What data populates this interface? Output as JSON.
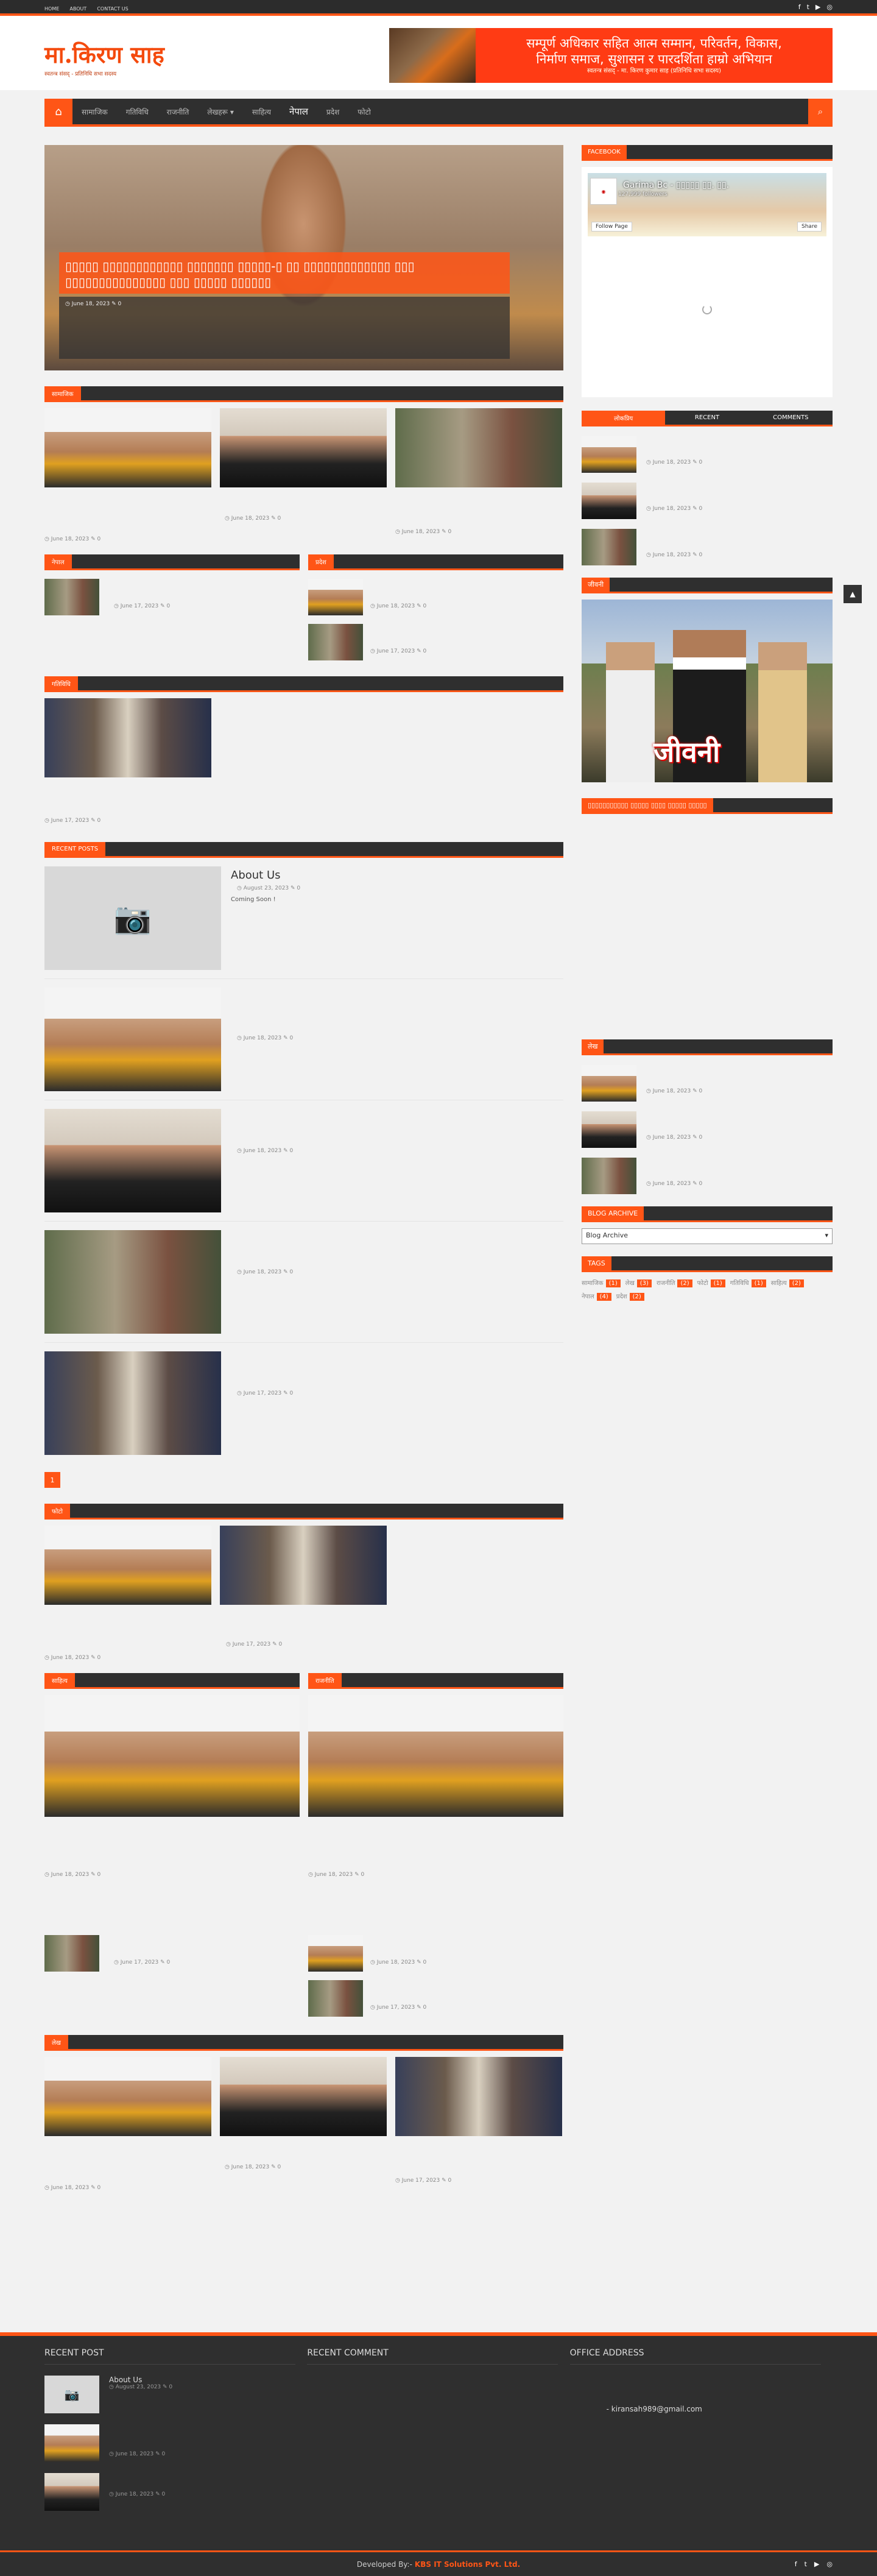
{
  "topbar": {
    "links": [
      "HOME",
      "ABOUT",
      "CONTACT US"
    ]
  },
  "brand": {
    "title": "मा.किरण साह",
    "subtitle": "स्वतन्त्र संसद्‌ - प्रतिनिधि सभा सदस्य"
  },
  "banner": {
    "line1": "सम्पूर्ण अधिकार सहित आत्म सम्मान, परिवर्तन, विकास,",
    "line2": "निर्माण समाज, सुशासन र पारदर्शिता हाम्रो अभियान",
    "line3": "स्वतन्त्र संसद् - मा. किरण कुमार साह (प्रतिनिधि सभा सदस्य)"
  },
  "nav": {
    "items": [
      "सामाजिक",
      "गतिविधि",
      "राजनीति",
      "लेखहरू ▾",
      "साहित्य",
      "नेपाल",
      "प्रदेश",
      "फोटो"
    ],
    "bold_item": "नेपाल",
    "bold_item_index": 5
  },
  "slider": {
    "caption": "▯▯▯▯▯ ▯▯▯▯▯▯▯▯▯▯▯▯ ▯▯▯▯▯▯▯ ▯▯▯▯▯-▯ ▯▯ ▯▯▯▯▯▯▯▯▯▯▯▯▯ ▯▯▯ ▯▯▯▯▯▯▯▯▯▯▯▯▯▯▯ ▯▯▯ ▯▯▯▯▯ ▯▯▯▯▯▯",
    "meta": "◷ June 18, 2023   ✎ 0"
  },
  "sections": {
    "s1": "सामाजिक",
    "s2": "नेपाल",
    "s3": "प्रदेश",
    "s4": "गतिविधि",
    "recent": "RECENT POSTS",
    "s5": "फोटो",
    "s6": "साहित्य",
    "s7": "राजनीति",
    "s8": "लेख"
  },
  "meta": {
    "jun18": "◷ June 18, 2023   ✎ 0",
    "jun17": "◷ June 17, 2023   ✎ 0",
    "aug23": "◷ August 23, 2023   ✎ 0"
  },
  "recent_posts": {
    "about_title": "About Us",
    "about_text": "Coming Soon !"
  },
  "pagination": {
    "current": "1"
  },
  "sidebar": {
    "facebook_title": "FACEBOOK",
    "fb_name": "Garima Bc - ▯▯▯▯▯ ▯▯. ▯▯.",
    "fb_followers": "127,999 followers",
    "fb_follow": "Follow Page",
    "fb_share": "Share",
    "tabs": [
      "लोकप्रिय",
      "RECENT",
      "COMMENTS"
    ],
    "widget2_title": "जीवनी",
    "jivani_text": "जीवनी",
    "jivani_caption": "▯▯▯▯▯▯▯▯▯▯▯ ▯▯▯▯▯ ▯▯▯▯ ▯▯▯▯▯ ▯▯▯▯▯",
    "widget3_title": "लेख",
    "archive_title": "BLOG ARCHIVE",
    "archive_value": "Blog Archive",
    "tags_title": "TAGS",
    "tags": [
      {
        "name": "सामाजिक",
        "count": "(1)"
      },
      {
        "name": "लेख",
        "count": "(3)"
      },
      {
        "name": "राजनीति",
        "count": "(2)"
      },
      {
        "name": "फोटो",
        "count": "(1)"
      },
      {
        "name": "गतिविधि",
        "count": "(1)"
      },
      {
        "name": "साहित्य",
        "count": "(2)"
      },
      {
        "name": "नेपाल",
        "count": "(4)"
      },
      {
        "name": "प्रदेश",
        "count": "(2)"
      }
    ]
  },
  "footer": {
    "col1": "RECENT POST",
    "col2": "RECENT COMMENT",
    "col3": "OFFICE ADDRESS",
    "about": "About Us",
    "email": "- kiransah989@gmail.com",
    "developed_by": "Developed By:-",
    "company": "KBS IT Solutions Pvt. Ltd."
  }
}
